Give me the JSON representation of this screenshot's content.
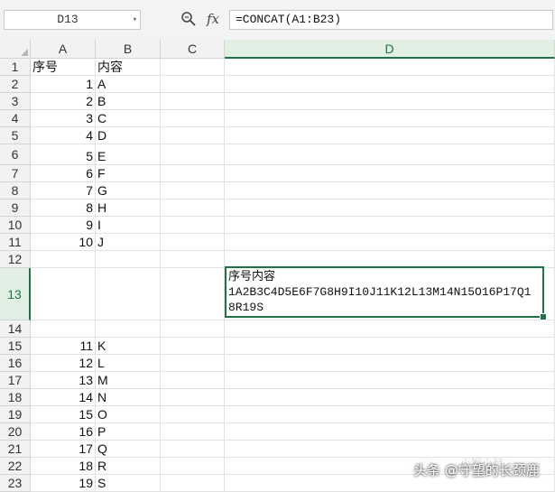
{
  "formula_bar": {
    "name_box": "D13",
    "zoom_icon": "zoom-icon",
    "fx_label": "fx",
    "formula": "=CONCAT(A1:B23)"
  },
  "columns": [
    "A",
    "B",
    "C",
    "D"
  ],
  "active": {
    "column": "D",
    "row": "13"
  },
  "rows": [
    {
      "n": "1",
      "a": "序号",
      "b": "内容"
    },
    {
      "n": "2",
      "a": "1",
      "b": "A"
    },
    {
      "n": "3",
      "a": "2",
      "b": "B"
    },
    {
      "n": "4",
      "a": "3",
      "b": "C"
    },
    {
      "n": "5",
      "a": "4",
      "b": "D"
    },
    {
      "n": "6",
      "a": "5",
      "b": "E"
    },
    {
      "n": "7",
      "a": "6",
      "b": "F"
    },
    {
      "n": "8",
      "a": "7",
      "b": "G"
    },
    {
      "n": "9",
      "a": "8",
      "b": "H"
    },
    {
      "n": "10",
      "a": "9",
      "b": "I"
    },
    {
      "n": "11",
      "a": "10",
      "b": "J"
    },
    {
      "n": "12",
      "a": "",
      "b": ""
    },
    {
      "n": "13",
      "a": "",
      "b": ""
    },
    {
      "n": "14",
      "a": "",
      "b": ""
    },
    {
      "n": "15",
      "a": "11",
      "b": "K"
    },
    {
      "n": "16",
      "a": "12",
      "b": "L"
    },
    {
      "n": "17",
      "a": "13",
      "b": "M"
    },
    {
      "n": "18",
      "a": "14",
      "b": "N"
    },
    {
      "n": "19",
      "a": "15",
      "b": "O"
    },
    {
      "n": "20",
      "a": "16",
      "b": "P"
    },
    {
      "n": "21",
      "a": "17",
      "b": "Q"
    },
    {
      "n": "22",
      "a": "18",
      "b": "R"
    },
    {
      "n": "23",
      "a": "19",
      "b": "S"
    }
  ],
  "d13": {
    "line1": "序号内容",
    "line2": "1A2B3C4D5E6F7G8H9I10J11K12L13M14N15O16P17Q1",
    "line3": "8R19S"
  },
  "watermark": "头条 @守望的长颈鹿",
  "watermark_faint": "小猴小鼠"
}
